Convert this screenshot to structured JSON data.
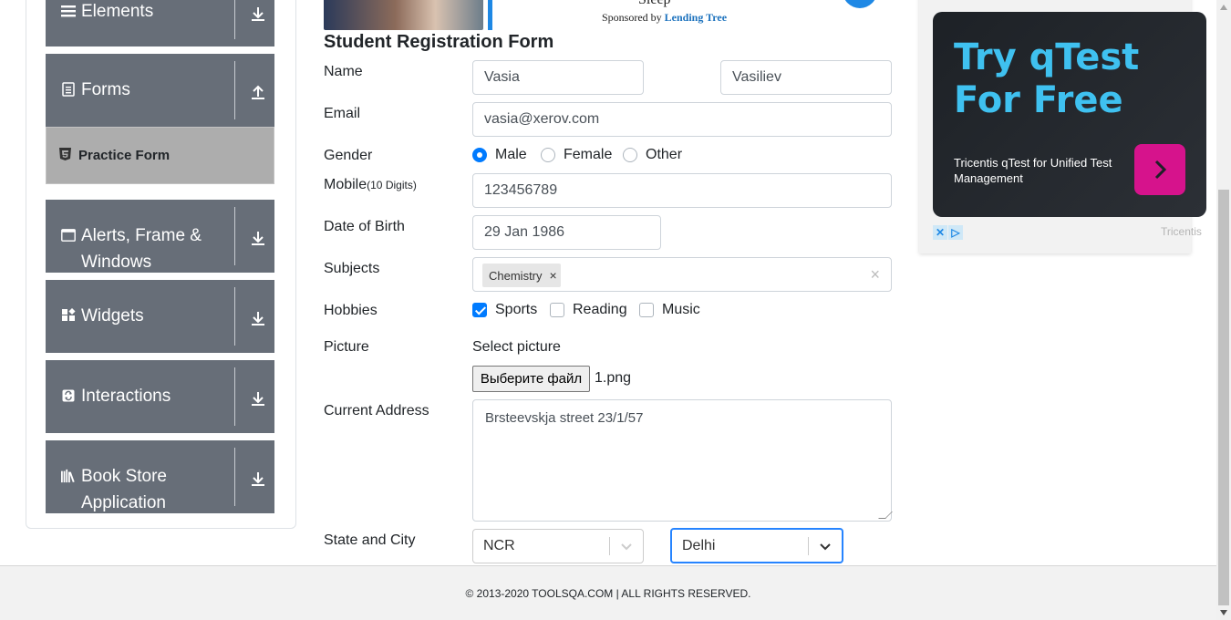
{
  "sidebar": {
    "groups": [
      {
        "label": "Elements",
        "icon": "hamburger-icon",
        "expanded": false
      },
      {
        "label": "Forms",
        "icon": "document-icon",
        "expanded": true
      },
      {
        "label": "Alerts, Frame & Windows",
        "icon": "window-icon",
        "expanded": false
      },
      {
        "label": "Widgets",
        "icon": "widgets-icon",
        "expanded": false
      },
      {
        "label": "Interactions",
        "icon": "interactions-icon",
        "expanded": false
      },
      {
        "label": "Book Store Application",
        "icon": "books-icon",
        "expanded": false
      }
    ],
    "active_item": {
      "label": "Practice Form",
      "icon": "html5-icon"
    }
  },
  "top_ad": {
    "headline": "Sleep",
    "sponsored_prefix": "Sponsored by",
    "sponsor": "Lending Tree"
  },
  "form": {
    "title": "Student Registration Form",
    "name": {
      "label": "Name",
      "first": "Vasia",
      "last": "Vasiliev"
    },
    "email": {
      "label": "Email",
      "value": "vasia@xerov.com"
    },
    "gender": {
      "label": "Gender",
      "options": [
        "Male",
        "Female",
        "Other"
      ],
      "selected": "Male"
    },
    "mobile": {
      "label": "Mobile",
      "hint": "(10 Digits)",
      "value": "123456789"
    },
    "dob": {
      "label": "Date of Birth",
      "value": "29 Jan 1986"
    },
    "subjects": {
      "label": "Subjects",
      "chips": [
        "Chemistry"
      ],
      "clear": "×",
      "remove": "×"
    },
    "hobbies": {
      "label": "Hobbies",
      "options": [
        "Sports",
        "Reading",
        "Music"
      ],
      "checked": [
        "Sports"
      ]
    },
    "picture": {
      "label": "Picture",
      "prompt": "Select picture",
      "button": "Выберите файл",
      "file": "1.png"
    },
    "address": {
      "label": "Current Address",
      "value": "Brsteevskja street 23/1/57"
    },
    "state_city": {
      "label": "State and City",
      "state": "NCR",
      "city": "Delhi"
    }
  },
  "side_ad": {
    "headline": "Try qTest For Free",
    "description": "Tricentis qTest for Unified Test Management",
    "brand": "Tricentis",
    "accent": "#3fc1f0",
    "cta_color": "#d6138c"
  },
  "footer": {
    "text": "© 2013-2020 TOOLSQA.COM | ALL RIGHTS RESERVED."
  }
}
